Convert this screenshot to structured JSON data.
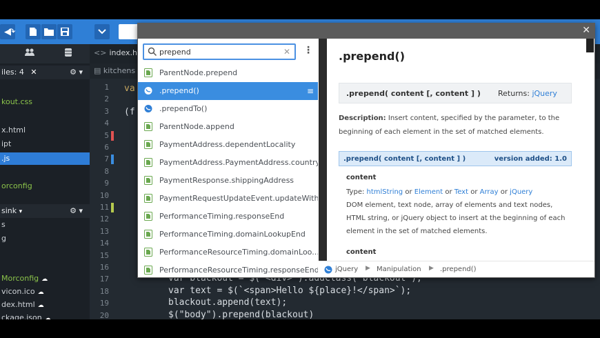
{
  "sidebar": {
    "files_header": "iles: 4",
    "rows": [
      {
        "text": "kout.css",
        "style": "green"
      },
      {
        "text": "x.html",
        "style": "normal"
      },
      {
        "text": "ipt",
        "style": "normal"
      },
      {
        "text": ".js",
        "style": "sel"
      },
      {
        "text": "orconfig",
        "style": "green"
      }
    ],
    "sink_header": "sink",
    "sink_rows": [
      {
        "text": "s"
      },
      {
        "text": "g"
      }
    ],
    "lower_rows": [
      {
        "text": "Morconfig",
        "style": "green",
        "cloud": true
      },
      {
        "text": "vicon.ico",
        "style": "normal",
        "cloud": true
      },
      {
        "text": "dex.html",
        "style": "normal",
        "cloud": true
      },
      {
        "text": "ckage.json",
        "style": "normal",
        "cloud": true
      }
    ]
  },
  "editor": {
    "tab_label": "index.ht",
    "breadcrumb": "kitchens",
    "line_numbers": [
      "1",
      "2",
      "3",
      "4",
      "5",
      "6",
      "7",
      "8",
      "9",
      "10",
      "11",
      "12",
      "13",
      "14",
      "15",
      "16",
      "17",
      "18",
      "19",
      "20"
    ],
    "code_frag_1": "va",
    "code_frag_3": "(f",
    "code": [
      {
        "line": 17,
        "text": "var blackout = $(\"<div>\").addClass(\"blackout\");"
      },
      {
        "line": 18,
        "text": "var text = $(`<span>Hello ${place}!</span>`);"
      },
      {
        "line": 19,
        "text": "blackout.append(text);"
      },
      {
        "line": 20,
        "text": "$(\"body\").prepend(blackout)"
      }
    ]
  },
  "popup": {
    "search_value": "prepend",
    "items": [
      {
        "label": "ParentNode.prepend",
        "icon": "dom-doc-icon",
        "selected": false
      },
      {
        "label": ".prepend()",
        "icon": "jquery-icon",
        "selected": true
      },
      {
        "label": ".prependTo()",
        "icon": "jquery-icon",
        "selected": false
      },
      {
        "label": "ParentNode.append",
        "icon": "dom-doc-icon",
        "selected": false
      },
      {
        "label": "PaymentAddress.dependentLocality",
        "icon": "dom-doc-icon",
        "selected": false
      },
      {
        "label": "PaymentAddress.PaymentAddress.country",
        "icon": "dom-doc-icon",
        "selected": false
      },
      {
        "label": "PaymentResponse.shippingAddress",
        "icon": "dom-doc-icon",
        "selected": false
      },
      {
        "label": "PaymentRequestUpdateEvent.updateWith",
        "icon": "dom-doc-icon",
        "selected": false
      },
      {
        "label": "PerformanceTiming.responseEnd",
        "icon": "dom-doc-icon",
        "selected": false
      },
      {
        "label": "PerformanceTiming.domainLookupEnd",
        "icon": "dom-doc-icon",
        "selected": false
      },
      {
        "label": "PerformanceResourceTiming.domainLoo...",
        "icon": "dom-doc-icon",
        "selected": false
      },
      {
        "label": "PerformanceResourceTiming.responseEnd",
        "icon": "dom-doc-icon",
        "selected": false
      }
    ],
    "doc": {
      "title": ".prepend()",
      "signature": ".prepend( content [, content ] )",
      "returns_label": "Returns:",
      "returns_type": "jQuery",
      "description_label": "Description:",
      "description": "Insert content, specified by the parameter, to the beginning of each element in the set of matched elements.",
      "version_signature": ".prepend( content [, content ] )",
      "version_added": "version added: 1.0",
      "param_name": "content",
      "type_label": "Type:",
      "types": [
        "htmlString",
        "Element",
        "Text",
        "Array",
        "jQuery"
      ],
      "type_sep": "or",
      "param_desc": "DOM element, text node, array of elements and text nodes, HTML string, or jQuery object to insert at the beginning of each element in the set of matched elements.",
      "param_name_2": "content"
    },
    "footer": {
      "library": "jQuery",
      "category": "Manipulation",
      "entry": ".prepend()"
    }
  },
  "colors": {
    "accent": "#2f7fd6",
    "selection": "#3a8de0",
    "link": "#2f7fd6",
    "mark_red": "#e05252",
    "mark_blue": "#3a8de0",
    "mark_green": "#b5c94e"
  }
}
